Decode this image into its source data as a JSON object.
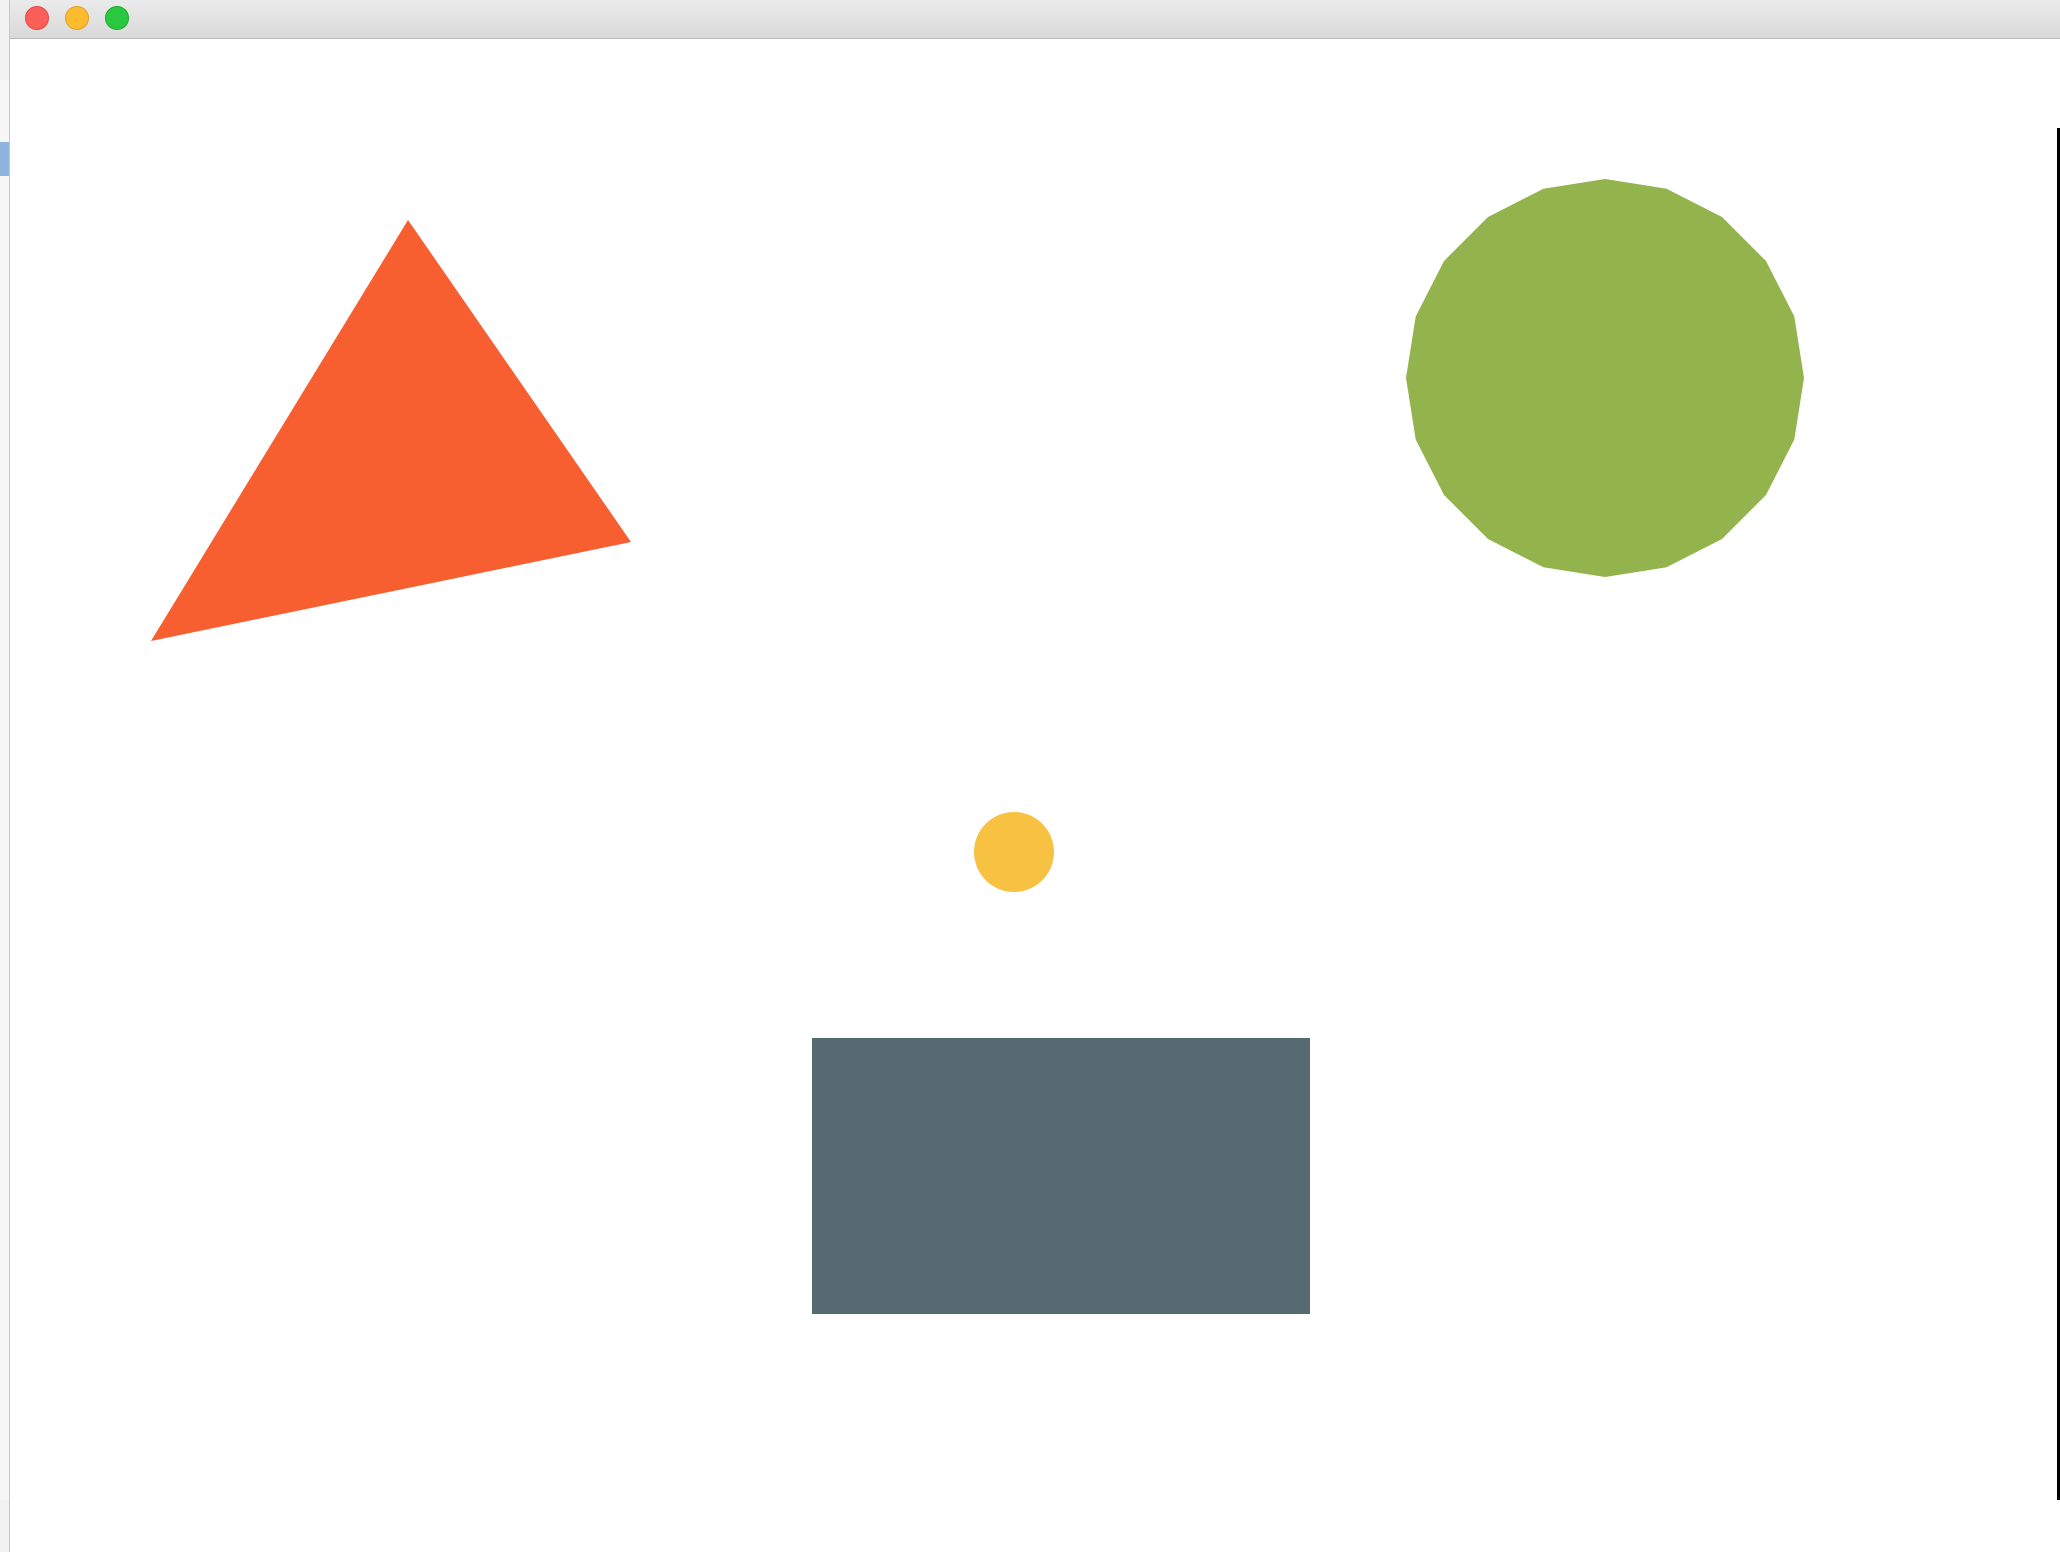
{
  "window": {
    "title": ""
  },
  "colors": {
    "triangle": "#f75e30",
    "circle_large": "#93b34d",
    "circle_small": "#f7c242",
    "rectangle": "#556b71"
  },
  "icons": {
    "close": "close-icon",
    "minimize": "minimize-icon",
    "zoom": "zoom-icon"
  }
}
